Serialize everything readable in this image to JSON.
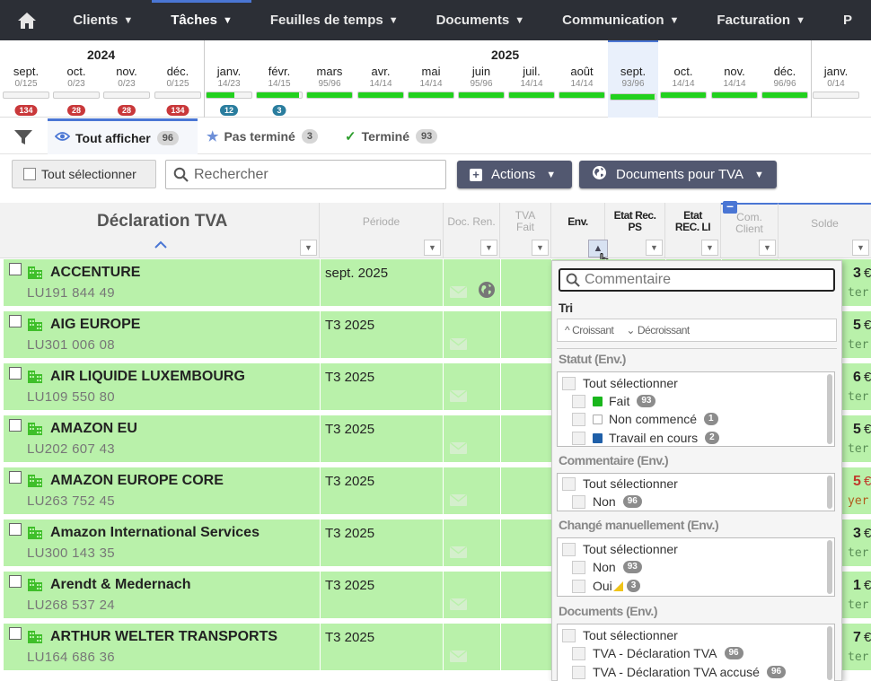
{
  "nav": {
    "items": [
      {
        "label": "Clients",
        "caret": "▼"
      },
      {
        "label": "Tâches",
        "caret": "▼"
      },
      {
        "label": "Feuilles de temps",
        "caret": "▼"
      },
      {
        "label": "Documents",
        "caret": "▼"
      },
      {
        "label": "Communication",
        "caret": "▼"
      },
      {
        "label": "Facturation",
        "caret": "▼"
      },
      {
        "label": "P",
        "caret": ""
      }
    ],
    "active_index": 1
  },
  "timeline": {
    "years": [
      "2024",
      "2025"
    ],
    "months": [
      {
        "name": "sept.",
        "count": "0/125",
        "progress": 0,
        "badge": "134",
        "badge_color": "#c9383a"
      },
      {
        "name": "oct.",
        "count": "0/23",
        "progress": 0,
        "badge": "28",
        "badge_color": "#c9383a"
      },
      {
        "name": "nov.",
        "count": "0/23",
        "progress": 0,
        "badge": "28",
        "badge_color": "#c9383a"
      },
      {
        "name": "déc.",
        "count": "0/125",
        "progress": 0,
        "badge": "134",
        "badge_color": "#c9383a"
      },
      {
        "name": "janv.",
        "count": "14/23",
        "progress": 0.61,
        "badge": "12",
        "badge_color": "#2a7d9e"
      },
      {
        "name": "févr.",
        "count": "14/15",
        "progress": 0.93,
        "badge": "3",
        "badge_color": "#2a7d9e"
      },
      {
        "name": "mars",
        "count": "95/96",
        "progress": 0.99,
        "badge": "",
        "badge_color": ""
      },
      {
        "name": "avr.",
        "count": "14/14",
        "progress": 1,
        "badge": "",
        "badge_color": ""
      },
      {
        "name": "mai",
        "count": "14/14",
        "progress": 1,
        "badge": "",
        "badge_color": ""
      },
      {
        "name": "juin",
        "count": "95/96",
        "progress": 0.99,
        "badge": "",
        "badge_color": ""
      },
      {
        "name": "juil.",
        "count": "14/14",
        "progress": 1,
        "badge": "",
        "badge_color": ""
      },
      {
        "name": "août",
        "count": "14/14",
        "progress": 1,
        "badge": "",
        "badge_color": ""
      },
      {
        "name": "sept.",
        "count": "93/96",
        "progress": 0.97,
        "badge": "",
        "badge_color": "",
        "current": true
      },
      {
        "name": "oct.",
        "count": "14/14",
        "progress": 1,
        "badge": "",
        "badge_color": ""
      },
      {
        "name": "nov.",
        "count": "14/14",
        "progress": 1,
        "badge": "",
        "badge_color": ""
      },
      {
        "name": "déc.",
        "count": "96/96",
        "progress": 1,
        "badge": "",
        "badge_color": ""
      },
      {
        "name": "janv.",
        "count": "0/14",
        "progress": 0,
        "badge": "",
        "badge_color": ""
      }
    ],
    "fill_color": "#22d11e"
  },
  "filters": {
    "tabs": [
      {
        "label": "Tout afficher",
        "count": "96",
        "icon": "eye-icon"
      },
      {
        "label": "Pas terminé",
        "count": "3",
        "icon": "star-icon"
      },
      {
        "label": "Terminé",
        "count": "93",
        "icon": "check-icon"
      }
    ]
  },
  "toolbar": {
    "select_all": "Tout sélectionner",
    "search_placeholder": "Rechercher",
    "actions": "Actions",
    "docs_tva": "Documents pour TVA"
  },
  "grid": {
    "title": "Déclaration TVA",
    "columns": {
      "periode": "Période",
      "doc_ren": "Doc. Ren.",
      "tva_fait_1": "TVA",
      "tva_fait_2": "Fait",
      "env": "Env.",
      "etat_ps_1": "Etat Rec.",
      "etat_ps_2": "PS",
      "etat_li_1": "Etat",
      "etat_li_2": "REC. LI",
      "com_1": "Com.",
      "com_2": "Client",
      "solde": "Solde"
    },
    "rows": [
      {
        "name": "ACCENTURE",
        "vat": "LU191 844 49",
        "period": "sept. 2025",
        "globe": true,
        "bal": "3",
        "bal_color": "#222",
        "eur": "€",
        "stat": "ter"
      },
      {
        "name": "AIG EUROPE",
        "vat": "LU301 006 08",
        "period": "T3 2025",
        "globe": false,
        "bal": "5",
        "bal_color": "#222",
        "eur": "€",
        "stat": "ter"
      },
      {
        "name": "AIR LIQUIDE LUXEMBOURG",
        "vat": "LU109 550 80",
        "period": "T3 2025",
        "globe": false,
        "bal": "6",
        "bal_color": "#222",
        "eur": "€",
        "stat": "ter"
      },
      {
        "name": "AMAZON EU",
        "vat": "LU202 607 43",
        "period": "T3 2025",
        "globe": false,
        "bal": "5",
        "bal_color": "#222",
        "eur": "€",
        "stat": "ter"
      },
      {
        "name": "AMAZON EUROPE CORE",
        "vat": "LU263 752 45",
        "period": "T3 2025",
        "globe": false,
        "bal": "5",
        "bal_color": "#c0392b",
        "eur": "€",
        "stat": "yer"
      },
      {
        "name": "Amazon International Services",
        "vat": "LU300 143 35",
        "period": "T3 2025",
        "globe": false,
        "bal": "3",
        "bal_color": "#222",
        "eur": "€",
        "stat": "ter"
      },
      {
        "name": "Arendt & Medernach",
        "vat": "LU268 537 24",
        "period": "T3 2025",
        "globe": false,
        "bal": "1",
        "bal_color": "#222",
        "eur": "€",
        "stat": "ter"
      },
      {
        "name": "ARTHUR WELTER TRANSPORTS",
        "vat": "LU164 686 36",
        "period": "T3 2025",
        "globe": false,
        "bal": "7",
        "bal_color": "#222",
        "eur": "€",
        "stat": "ter"
      }
    ]
  },
  "panel": {
    "search_placeholder": "Commentaire",
    "tri_title": "Tri",
    "sort_asc": "Croissant",
    "sort_desc": "Décroissant",
    "statut_title": "Statut (Env.)",
    "select_all": "Tout sélectionner",
    "statut_items": [
      {
        "label": "Fait",
        "count": "93",
        "color": "#19b61c"
      },
      {
        "label": "Non commencé",
        "count": "1",
        "color": "#ffffff"
      },
      {
        "label": "Travail en cours",
        "count": "2",
        "color": "#1f5fa8"
      }
    ],
    "commentaire_title": "Commentaire (Env.)",
    "commentaire_items": [
      {
        "label": "Non",
        "count": "96"
      }
    ],
    "change_title": "Changé manuellement (Env.)",
    "change_items": [
      {
        "label": "Non",
        "count": "93"
      },
      {
        "label": "Oui",
        "count": "3"
      }
    ],
    "documents_title": "Documents (Env.)",
    "documents_items": [
      {
        "label": "TVA - Déclaration TVA",
        "count": "96"
      },
      {
        "label": "TVA - Déclaration TVA accusé",
        "count": "96"
      }
    ]
  }
}
